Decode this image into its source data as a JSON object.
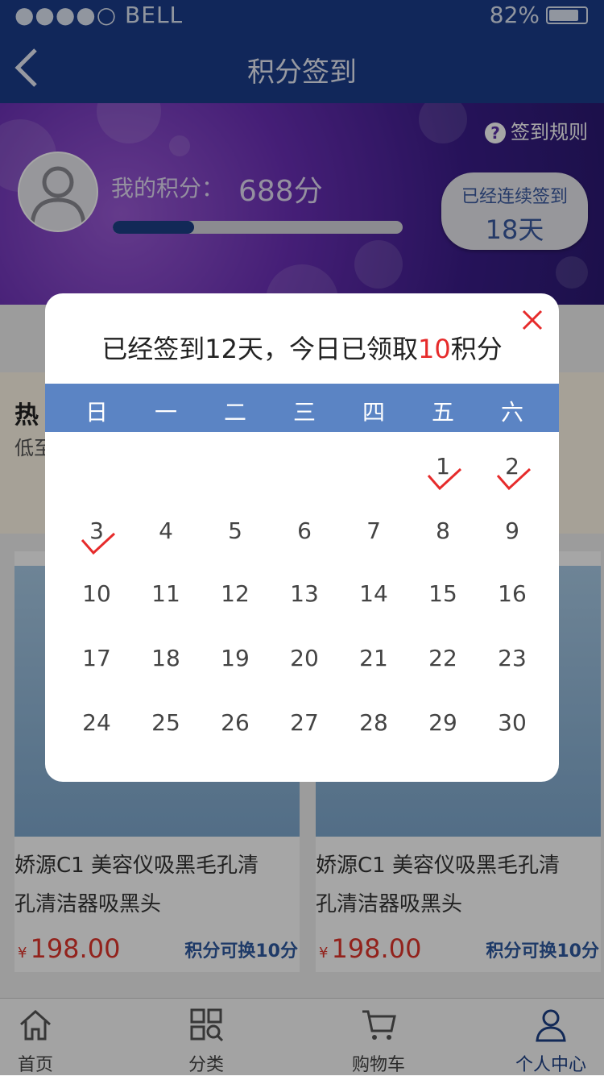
{
  "status_bar": {
    "carrier": "●●●●○ BELL",
    "battery": "82%"
  },
  "nav": {
    "title": "积分签到"
  },
  "header": {
    "rules_label": "签到规则",
    "points_label": "我的积分：",
    "points_value": "688分",
    "progress_fraction": 0.28,
    "streak_label": "已经连续签到",
    "streak_value": "18天"
  },
  "modal": {
    "title_prefix": "已经签到12天，今日已领取",
    "title_points": "10",
    "title_suffix": "积分",
    "weekdays": [
      "日",
      "一",
      "二",
      "三",
      "四",
      "五",
      "六"
    ],
    "days": [
      "1",
      "2",
      "3",
      "4",
      "5",
      "6",
      "7",
      "8",
      "9",
      "10",
      "11",
      "12",
      "13",
      "14",
      "15",
      "16",
      "17",
      "18",
      "19",
      "20",
      "21",
      "22",
      "23",
      "24",
      "25",
      "26",
      "27",
      "28",
      "29",
      "30"
    ],
    "checked_days": [
      "1",
      "2",
      "3"
    ]
  },
  "promo": {
    "title": "热",
    "subtitle": "低至"
  },
  "products": [
    {
      "name_line1": "娇源C1 美容仪吸黑毛孔清",
      "name_line2": "孔清洁器吸黑头",
      "price_symbol": "¥",
      "price": "198.00",
      "exchange": "积分可换10分"
    },
    {
      "name_line1": "娇源C1 美容仪吸黑毛孔清",
      "name_line2": "孔清洁器吸黑头",
      "price_symbol": "¥",
      "price": "198.00",
      "exchange": "积分可换10分"
    }
  ],
  "tabs": [
    {
      "label": "首页",
      "icon": "home-icon"
    },
    {
      "label": "分类",
      "icon": "category-icon"
    },
    {
      "label": "购物车",
      "icon": "cart-icon"
    },
    {
      "label": "个人中心",
      "icon": "user-icon"
    }
  ],
  "colors": {
    "nav": "#1b3d8a",
    "accent_red": "#e62b2b",
    "weekday_bar": "#5b84c4"
  }
}
